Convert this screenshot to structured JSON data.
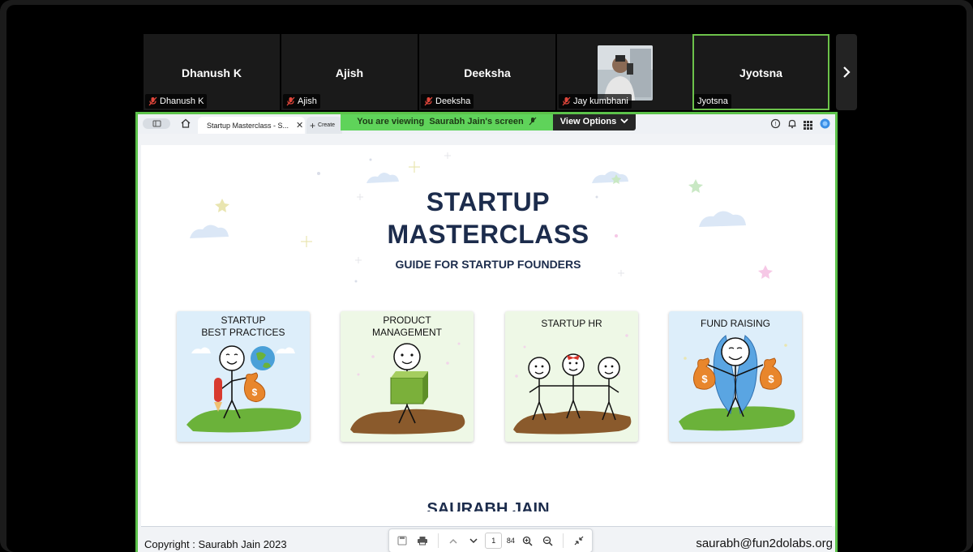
{
  "participants": [
    {
      "display_name": "Dhanush K",
      "label": "Dhanush K"
    },
    {
      "display_name": "Ajish",
      "label": "Ajish"
    },
    {
      "display_name": "Deeksha",
      "label": "Deeksha"
    },
    {
      "display_name": "",
      "label": "Jay kumbhani"
    },
    {
      "display_name": "Jyotsna",
      "label": "Jyotsna"
    }
  ],
  "share_banner": {
    "viewing_text": "You are viewing  Saurabh Jain's screen",
    "view_options_label": "View Options"
  },
  "browser": {
    "active_tab_title": "Startup Masterclass - S...",
    "new_tab_label": "Create"
  },
  "slide": {
    "title_line1": "STARTUP",
    "title_line2": "MASTERCLASS",
    "subtitle": "GUIDE FOR STARTUP FOUNDERS",
    "cards": [
      {
        "title": "STARTUP\nBEST PRACTICES"
      },
      {
        "title": "PRODUCT\nMANAGEMENT"
      },
      {
        "title": "STARTUP HR"
      },
      {
        "title": "FUND RAISING"
      }
    ],
    "author": "SAURABH JAIN",
    "copyright": "Copyright : Saurabh Jain 2023",
    "email": "saurabh@fun2dolabs.org"
  },
  "pdf_toolbar": {
    "current_page": "1",
    "total_pages": "84"
  },
  "colors": {
    "active_border": "#5cc24a",
    "banner_green": "#5fd35a",
    "title_navy": "#1c2c4c"
  }
}
